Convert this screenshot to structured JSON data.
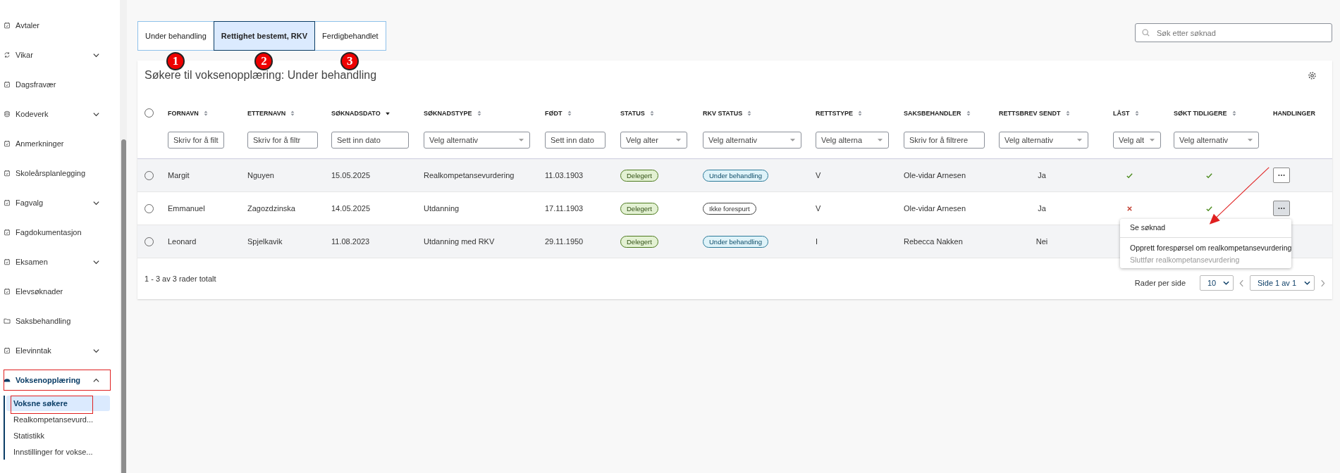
{
  "sidebar": {
    "items": [
      {
        "label": "Avtaler",
        "selected": false
      },
      {
        "label": "Vikar",
        "expanded": false,
        "selected": false
      },
      {
        "label": "Dagsfravær",
        "selected": false
      },
      {
        "label": "Kodeverk",
        "expanded": false,
        "selected": false
      },
      {
        "label": "Anmerkninger",
        "selected": false
      },
      {
        "label": "Skoleårsplanlegging",
        "selected": false
      },
      {
        "label": "Fagvalg",
        "expanded": false,
        "selected": false
      },
      {
        "label": "Fagdokumentasjon",
        "selected": false
      },
      {
        "label": "Eksamen",
        "expanded": false,
        "selected": false
      },
      {
        "label": "Elevsøknader",
        "selected": false
      },
      {
        "label": "Saksbehandling",
        "selected": false
      },
      {
        "label": "Elevinntak",
        "expanded": false,
        "selected": false
      },
      {
        "label": "Voksenopplæring",
        "expanded": true,
        "selected": true,
        "children": [
          {
            "label": "Voksne søkere",
            "selected": true
          },
          {
            "label": "Realkompetansevurd...",
            "selected": false
          },
          {
            "label": "Statistikk",
            "selected": false
          },
          {
            "label": "Innstillinger for vokse...",
            "selected": false
          }
        ]
      }
    ]
  },
  "tabs": [
    {
      "label": "Under behandling",
      "selected": false,
      "marker": "1"
    },
    {
      "label": "Rettighet bestemt, RKV",
      "selected": true,
      "marker": "2"
    },
    {
      "label": "Ferdigbehandlet",
      "selected": false,
      "marker": "3"
    }
  ],
  "search": {
    "placeholder": "Søk etter søknad"
  },
  "table": {
    "title": "Søkere til voksenopplæring: Under behandling",
    "select_all": {
      "checked": false
    },
    "columns": [
      {
        "label": "FORNAVN",
        "sorted": false,
        "filter": {
          "kind": "text",
          "placeholder": "Skriv for å filt"
        }
      },
      {
        "label": "ETTERNAVN",
        "sorted": false,
        "filter": {
          "kind": "text",
          "placeholder": "Skriv for å filtr"
        }
      },
      {
        "label": "SØKNADSDATO",
        "sorted": true,
        "filter": {
          "kind": "text",
          "placeholder": "Sett inn dato"
        }
      },
      {
        "label": "SØKNADSTYPE",
        "sorted": false,
        "filter": {
          "kind": "select",
          "placeholder": "Velg alternativ"
        }
      },
      {
        "label": "FØDT",
        "sorted": false,
        "filter": {
          "kind": "text",
          "placeholder": "Sett inn dato"
        }
      },
      {
        "label": "STATUS",
        "sorted": false,
        "filter": {
          "kind": "select",
          "placeholder": "Velg alter"
        }
      },
      {
        "label": "RKV STATUS",
        "sorted": false,
        "filter": {
          "kind": "select",
          "placeholder": "Velg alternativ"
        }
      },
      {
        "label": "RETTSTYPE",
        "sorted": false,
        "filter": {
          "kind": "select",
          "placeholder": "Velg alterna"
        }
      },
      {
        "label": "SAKSBEHANDLER",
        "sorted": false,
        "filter": {
          "kind": "text",
          "placeholder": "Skriv for å filtrere"
        }
      },
      {
        "label": "RETTSBREV SENDT",
        "sorted": false,
        "filter": {
          "kind": "select",
          "placeholder": "Velg alternativ"
        }
      },
      {
        "label": "LÅST",
        "sorted": false,
        "filter": {
          "kind": "select",
          "placeholder": "Velg alt"
        }
      },
      {
        "label": "SØKT TIDLIGERE",
        "sorted": false,
        "filter": {
          "kind": "select",
          "placeholder": "Velg alternativ"
        }
      },
      {
        "label": "HANDLINGER"
      }
    ],
    "rows": [
      {
        "selected": false,
        "first_name": "Margit",
        "last_name": "Nguyen",
        "date": "15.05.2025",
        "type": "Realkompetansevurdering",
        "born": "11.03.1903",
        "status": {
          "label": "Delegert",
          "kind": "green"
        },
        "rkv_status": {
          "label": "Under behandling",
          "kind": "blue"
        },
        "rettstype": "V",
        "saksbehandler": "Ole-vidar Arnesen",
        "rettsbrev": "Ja",
        "locked": true,
        "applied_before": true,
        "menu_open": false
      },
      {
        "selected": false,
        "first_name": "Emmanuel",
        "last_name": "Zagozdzinska",
        "date": "14.05.2025",
        "type": "Utdanning",
        "born": "17.11.1903",
        "status": {
          "label": "Delegert",
          "kind": "green"
        },
        "rkv_status": {
          "label": "Ikke forespurt",
          "kind": "neutral"
        },
        "rettstype": "V",
        "saksbehandler": "Ole-vidar Arnesen",
        "rettsbrev": "Ja",
        "locked": false,
        "applied_before": true,
        "menu_open": true
      },
      {
        "selected": false,
        "first_name": "Leonard",
        "last_name": "Spjelkavik",
        "date": "11.08.2023",
        "type": "Utdanning med RKV",
        "born": "29.11.1950",
        "status": {
          "label": "Delegert",
          "kind": "green"
        },
        "rkv_status": {
          "label": "Under behandling",
          "kind": "blue"
        },
        "rettstype": "I",
        "saksbehandler": "Rebecca Nakken",
        "rettsbrev": "Nei"
      }
    ],
    "menu": [
      {
        "label": "Se søknad",
        "disabled": false,
        "divider_before": false
      },
      {
        "label": "Opprett forespørsel om realkompetansevurdering",
        "disabled": false,
        "divider_before": true
      },
      {
        "label": "Sluttfør realkompetansevurdering",
        "disabled": true,
        "divider_before": false
      }
    ],
    "footer": {
      "summary": "1 - 3 av 3 rader totalt",
      "rows_per_page_label": "Rader per side",
      "rows_per_page": "10",
      "page": "Side 1 av 1"
    }
  }
}
